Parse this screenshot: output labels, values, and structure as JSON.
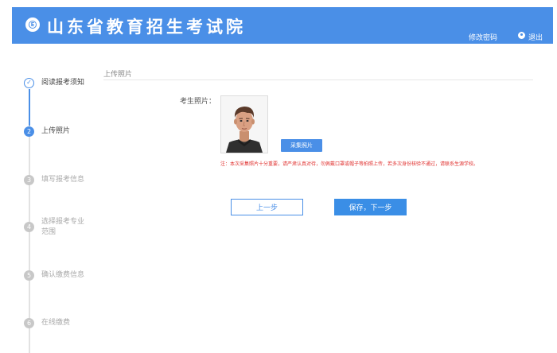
{
  "header": {
    "logo_letter": "E",
    "title": "山东省教育招生考试院",
    "change_password": "修改密码",
    "logout": "退出",
    "background_color": "#4a8fe7"
  },
  "steps": [
    {
      "number": "✓",
      "label": "阅读报考须知",
      "state": "done"
    },
    {
      "number": "2",
      "label": "上传照片",
      "state": "active"
    },
    {
      "number": "3",
      "label": "填写报考信息",
      "state": "pending"
    },
    {
      "number": "4",
      "label": "选择报考专业范围",
      "state": "pending"
    },
    {
      "number": "5",
      "label": "确认缴费信息",
      "state": "pending"
    },
    {
      "number": "6",
      "label": "在线缴费",
      "state": "pending"
    }
  ],
  "main": {
    "section_title": "上传照片",
    "photo_label": "考生照片：",
    "capture_button": "采集照片",
    "note": "注：本次采集照片十分重要，请严肃认真对待，勿佩戴口罩或帽子等拍照上传，若多次身份核验不通过，请联系生源学校。",
    "prev_button": "上一步",
    "next_button": "保存，下一步"
  },
  "colors": {
    "accent": "#4a8fe7",
    "warning": "#e0302e"
  }
}
